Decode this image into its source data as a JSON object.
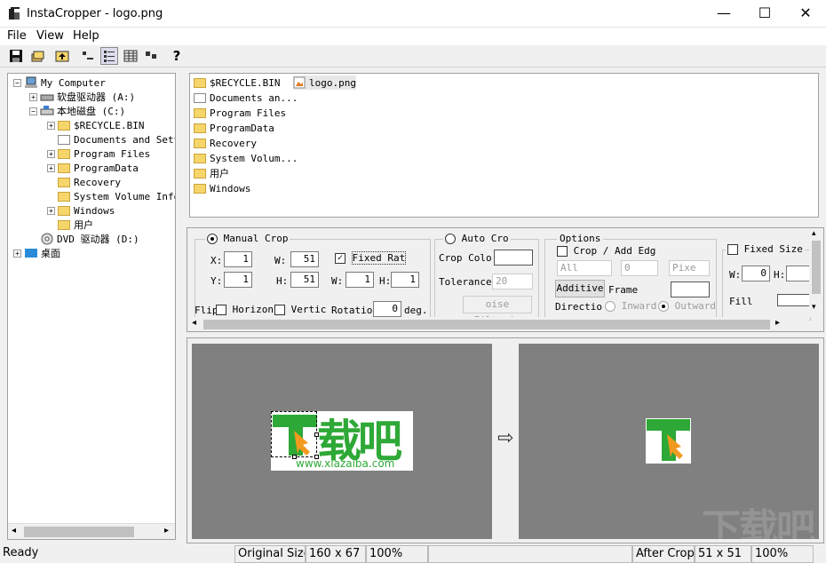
{
  "window": {
    "title": "InstaCropper - logo.png",
    "minimize": "—",
    "maximize": "☐",
    "close": "✕"
  },
  "menu": [
    "File",
    "View",
    "Help"
  ],
  "toolbar": {
    "help": "?"
  },
  "tree": {
    "root": "My Computer",
    "floppy": "软盘驱动器 (A:)",
    "local": "本地磁盘 (C:)",
    "folders": [
      "$RECYCLE.BIN",
      "Documents and Sett",
      "Program Files",
      "ProgramData",
      "Recovery",
      "System Volume Info",
      "Windows",
      "用户"
    ],
    "dvd": "DVD 驱动器 (D:)",
    "desktop": "桌面"
  },
  "files": {
    "col1": [
      "$RECYCLE.BIN",
      "Documents an...",
      "Program Files",
      "ProgramData",
      "Recovery",
      "System Volum...",
      "用户",
      "Windows"
    ],
    "logo": "logo.png"
  },
  "manual": {
    "title": "Manual Crop",
    "x_label": "X:",
    "x": "1",
    "w_label": "W:",
    "w": "51",
    "fixed": "Fixed Rat",
    "y_label": "Y:",
    "y": "1",
    "h_label": "H:",
    "h": "51",
    "w2_label": "W:",
    "w2": "1",
    "h2_label": "H:",
    "h2": "1",
    "flip": "Flip",
    "horiz": "Horizont",
    "vert": "Vertic",
    "rotation": "Rotation",
    "rot_val": "0",
    "deg": "deg."
  },
  "auto": {
    "title": "Auto Cro",
    "crop_color": "Crop Colo",
    "tolerance": "Tolerance",
    "tol_val": "20",
    "noise": "oise Filterin"
  },
  "options": {
    "title": "Options",
    "crop_add": "Crop / Add Edg",
    "all": "All",
    "zero": "0",
    "pixel": "Pixe",
    "additive": "Additive",
    "frame": "Frame",
    "direction": "Directio",
    "inward": "Inward",
    "outward": "Outward"
  },
  "fixed_size": {
    "title": "Fixed Size",
    "w_label": "W:",
    "w": "0",
    "h_label": "H:",
    "fill": "Fill"
  },
  "preview": {
    "logo_text": "载吧",
    "url": "www.xiazaiba.com",
    "arrow": "⇨",
    "watermark": "下载吧"
  },
  "status": {
    "ready": "Ready",
    "orig_label": "Original Size",
    "orig_size": "160 x 67",
    "orig_zoom": "100%",
    "after_label": "After Crop",
    "after_size": "51 x 51",
    "after_zoom": "100%"
  }
}
